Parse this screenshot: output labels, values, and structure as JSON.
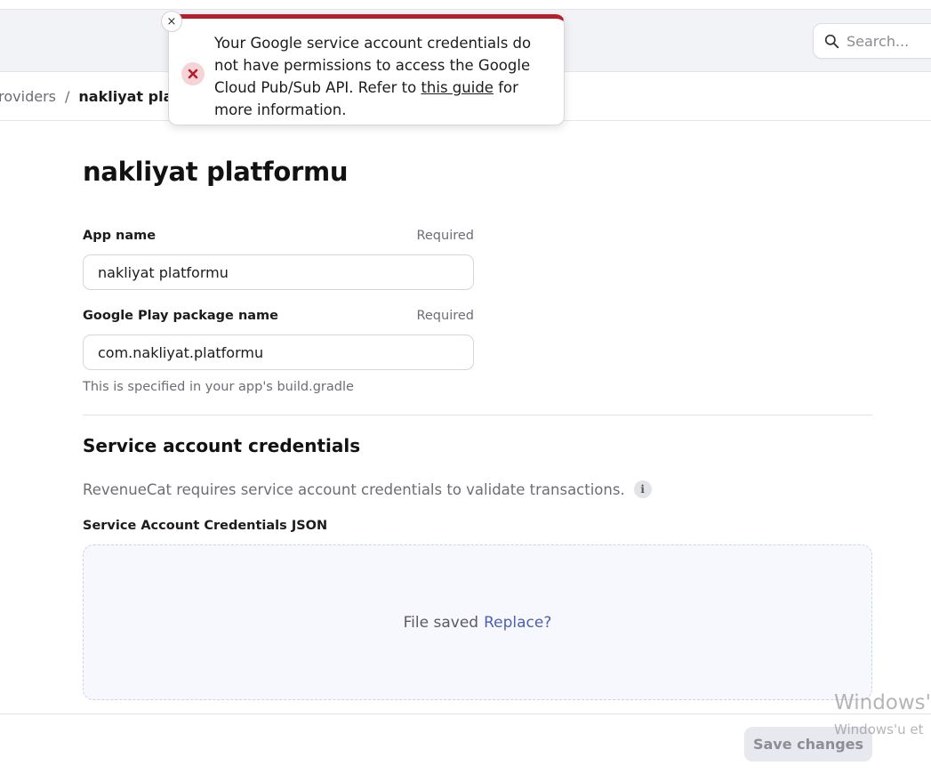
{
  "search": {
    "placeholder": "Search..."
  },
  "breadcrumb": {
    "parent": "providers",
    "separator": "/",
    "current": "nakliyat platformu"
  },
  "toast": {
    "close": "×",
    "message_before_link": "Your Google service account credentials do not have permissions to access the Google Cloud Pub/Sub API. Refer to ",
    "link_text": "this guide",
    "message_after_link": " for more information."
  },
  "page": {
    "title": "nakliyat platformu"
  },
  "form": {
    "app_name": {
      "label": "App name",
      "required": "Required",
      "value": "nakliyat platformu"
    },
    "package_name": {
      "label": "Google Play package name",
      "required": "Required",
      "value": "com.nakliyat.platformu",
      "hint": "This is specified in your app's build.gradle"
    }
  },
  "credentials": {
    "title": "Service account credentials",
    "description": "RevenueCat requires service account credentials to validate transactions.",
    "info_glyph": "i",
    "json_label": "Service Account Credentials JSON",
    "file_status": "File saved",
    "replace_label": "Replace?"
  },
  "footer": {
    "save_label": "Save changes"
  },
  "watermark": {
    "line1": "Windows'",
    "line2": "Windows'u et"
  },
  "colors": {
    "error_accent": "#b3202b",
    "link": "#4d5fb3"
  }
}
